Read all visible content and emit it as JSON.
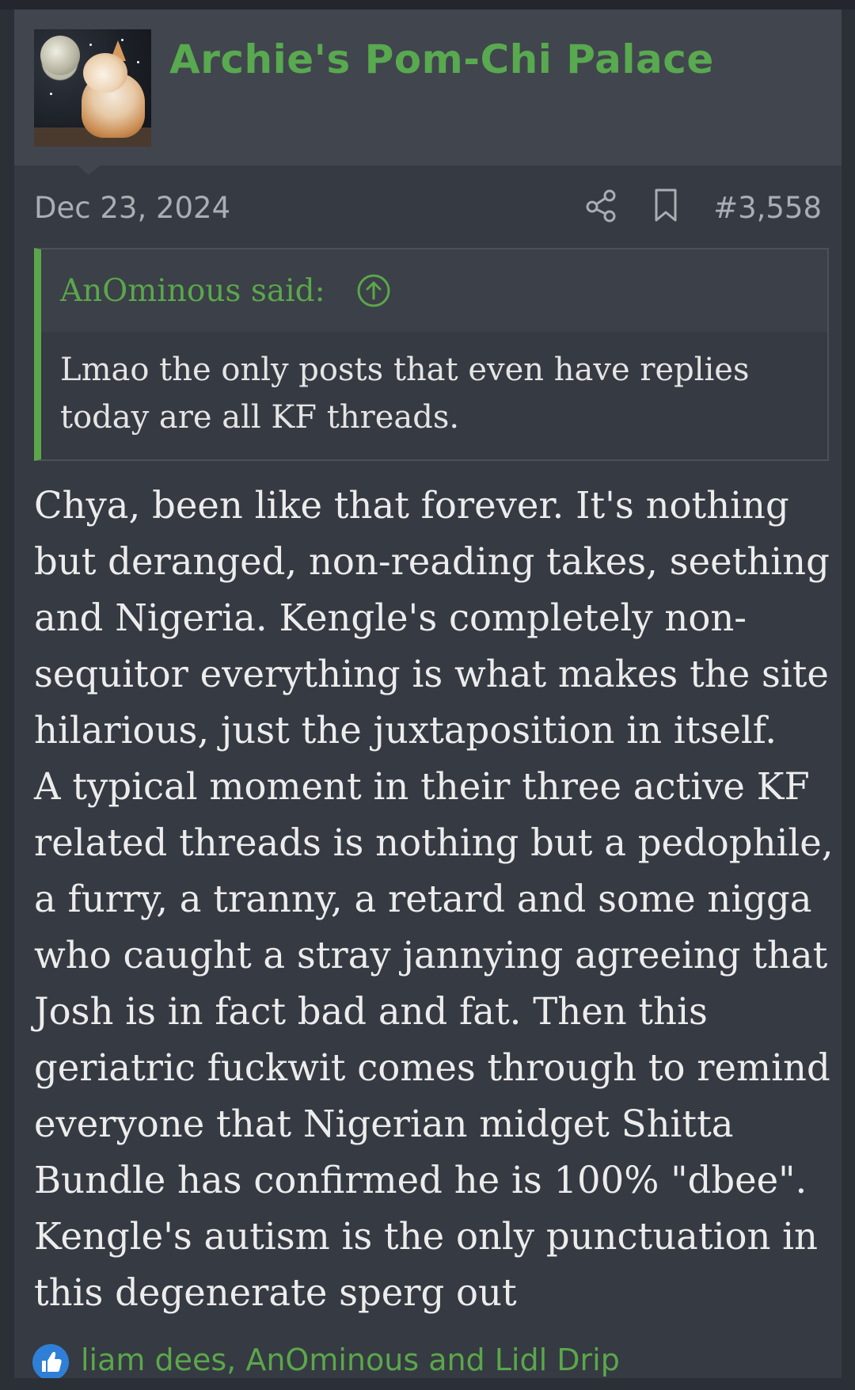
{
  "post": {
    "username": "Archie's Pom-Chi Palace",
    "date": "Dec 23, 2024",
    "post_number": "#3,558",
    "quote": {
      "author_label": "AnOminous said:",
      "text": "Lmao the only posts that even have replies today are all KF threads."
    },
    "body_paragraphs": [
      "Chya, been like that forever. It's nothing but deranged, non-reading takes, seething and Nigeria. Kengle's completely non-sequitor everything is what makes the site hilarious, just the juxtaposition in itself.",
      "A typical moment in their three active KF related threads is nothing but a pedophile, a furry, a tranny, a retard and some nigga who caught a stray jannying agreeing that Josh is in fact bad and fat. Then this geriatric fuckwit comes through to remind everyone that Nigerian midget Shitta Bundle has confirmed he is 100% \"dbee\". Kengle's autism is the only punctuation in this degenerate sperg out"
    ],
    "reactions": {
      "icon": "thumbs-up-icon",
      "users": "liam dees, AnOminous and Lidl Drip"
    }
  },
  "icons": {
    "share": "share-icon",
    "bookmark": "bookmark-icon",
    "quote_jump": "arrow-up-circle-icon"
  },
  "colors": {
    "accent_green": "#58a94f",
    "background": "#363a42",
    "header": "#41454d",
    "text": "#ececec",
    "muted": "#a9adb4"
  }
}
